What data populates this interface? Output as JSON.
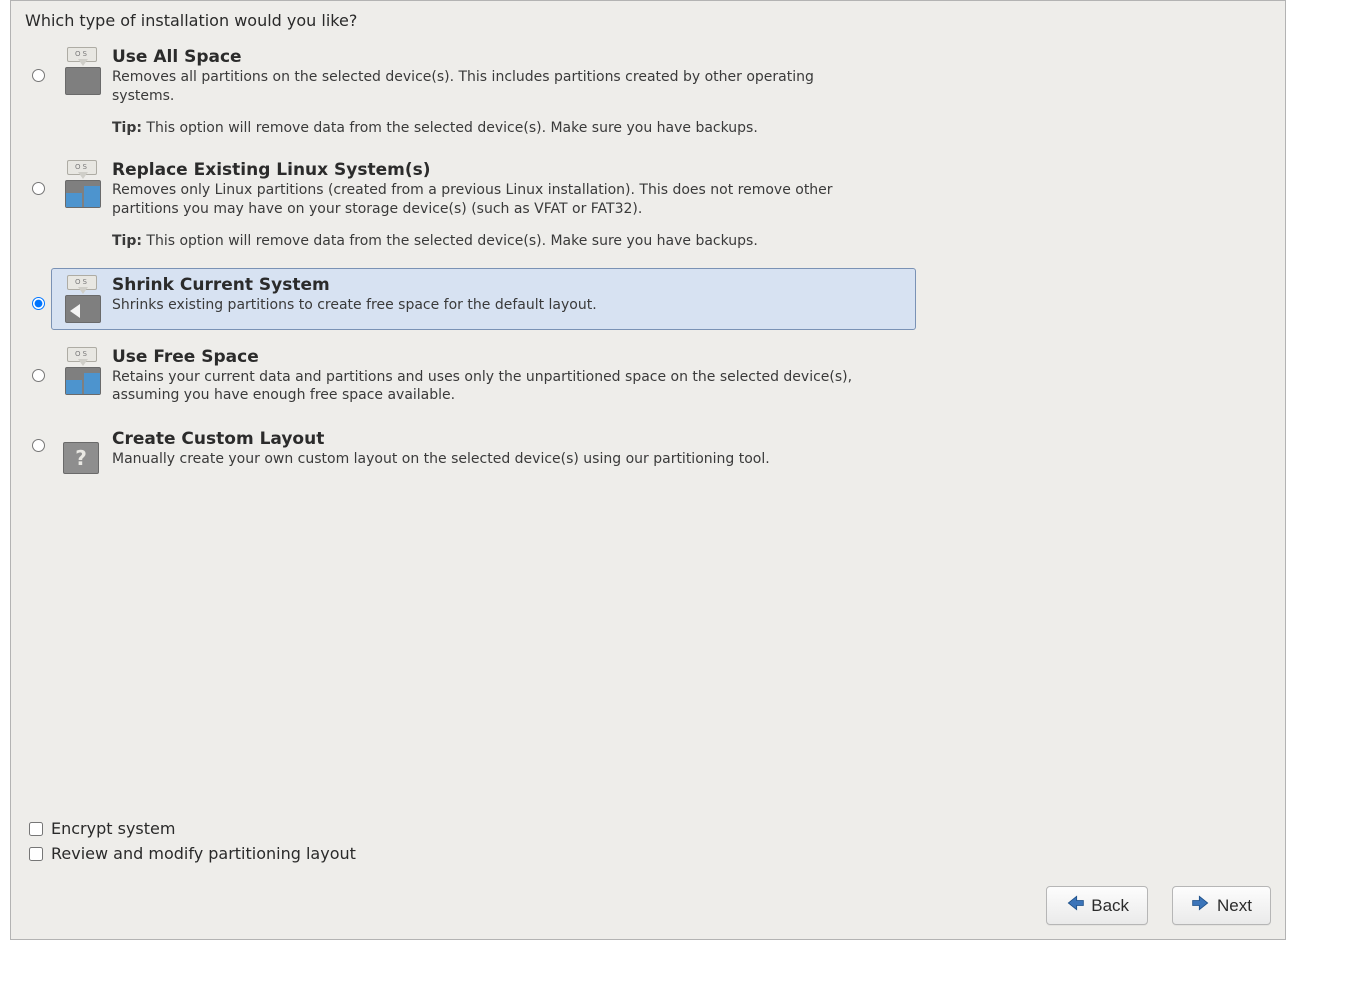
{
  "prompt": "Which type of installation would you like?",
  "tip_label": "Tip:",
  "options": [
    {
      "id": "use-all-space",
      "title": "Use All Space",
      "desc": "Removes all partitions on the selected device(s).  This includes partitions created by other operating systems.",
      "tip": "This option will remove data from the selected device(s).  Make sure you have backups.",
      "selected": false
    },
    {
      "id": "replace-existing-linux",
      "title": "Replace Existing Linux System(s)",
      "desc": "Removes only Linux partitions (created from a previous Linux installation).  This does not remove other partitions you may have on your storage device(s) (such as VFAT or FAT32).",
      "tip": "This option will remove data from the selected device(s).  Make sure you have backups.",
      "selected": false
    },
    {
      "id": "shrink-current-system",
      "title": "Shrink Current System",
      "desc": "Shrinks existing partitions to create free space for the default layout.",
      "tip": null,
      "selected": true
    },
    {
      "id": "use-free-space",
      "title": "Use Free Space",
      "desc": "Retains your current data and partitions and uses only the unpartitioned space on the selected device(s), assuming you have enough free space available.",
      "tip": null,
      "selected": false
    },
    {
      "id": "create-custom-layout",
      "title": "Create Custom Layout",
      "desc": "Manually create your own custom layout on the selected device(s) using our partitioning tool.",
      "tip": null,
      "selected": false
    }
  ],
  "checkboxes": {
    "encrypt": {
      "label": "Encrypt system",
      "checked": false
    },
    "review": {
      "label": "Review and modify partitioning layout",
      "checked": false
    }
  },
  "buttons": {
    "back": "Back",
    "next": "Next"
  }
}
